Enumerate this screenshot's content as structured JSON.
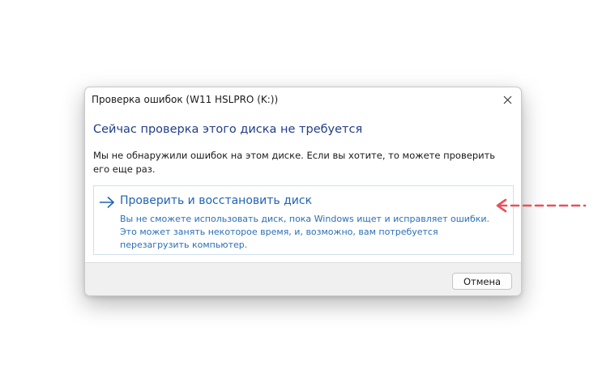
{
  "dialog": {
    "title": "Проверка ошибок (W11 HSLPRO (K:))",
    "close_icon": "close-icon",
    "heading": "Сейчас проверка этого диска не требуется",
    "message": "Мы не обнаружили ошибок на этом диске. Если вы хотите, то можете проверить его еще раз.",
    "action": {
      "icon": "arrow-right-icon",
      "title": "Проверить и восстановить диск",
      "description": "Вы не сможете использовать диск, пока Windows ищет и исправляет ошибки. Это может занять некоторое время, и, возможно, вам потребуется перезагрузить компьютер."
    },
    "cancel_label": "Отмена"
  },
  "annotation": {
    "icon": "dashed-arrow-left-icon",
    "color": "#e8505b"
  },
  "colors": {
    "heading": "#1f3d8a",
    "link": "#1e63b5",
    "footer_bg": "#f0f0f0"
  }
}
